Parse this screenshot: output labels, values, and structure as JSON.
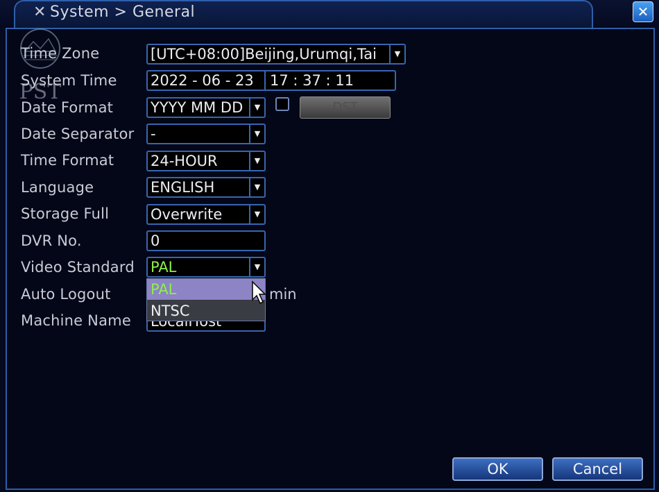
{
  "window": {
    "title": "System > General",
    "app_icon": "wrench-screwdriver-icon",
    "close_icon": "close-x-icon"
  },
  "watermark": {
    "text": "PST"
  },
  "labels": {
    "time_zone": "Time Zone",
    "system_time": "System Time",
    "date_format": "Date Format",
    "date_separator": "Date Separator",
    "time_format": "Time Format",
    "language": "Language",
    "storage_full": "Storage Full",
    "dvr_no": "DVR No.",
    "video_standard": "Video Standard",
    "auto_logout": "Auto Logout",
    "machine_name": "Machine Name"
  },
  "values": {
    "time_zone": "[UTC+08:00]Beijing,Urumqi,Tai",
    "system_date": "2022 - 06 - 23",
    "system_clock": "17 : 37 : 11",
    "date_format": "YYYY MM DD",
    "date_separator": "-",
    "time_format": "24-HOUR",
    "language": "ENGLISH",
    "storage_full": "Overwrite",
    "dvr_no": "0",
    "video_standard": "PAL",
    "machine_name": "LocalHost",
    "auto_logout_unit": "min"
  },
  "dst_button": {
    "label": "DST",
    "enabled": false
  },
  "dst_checkbox": {
    "checked": false
  },
  "video_standard_options": [
    {
      "label": "PAL",
      "highlighted": true
    },
    {
      "label": "NTSC",
      "highlighted": false
    }
  ],
  "buttons": {
    "ok": "OK",
    "cancel": "Cancel"
  },
  "colors": {
    "background": "#030718",
    "border": "#3866b0",
    "selected_value": "#8ef04a",
    "highlight": "#8c84c4"
  }
}
